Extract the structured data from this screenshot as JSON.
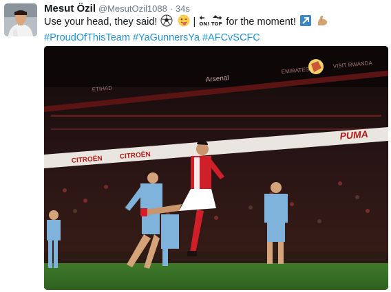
{
  "tweet": {
    "author_name": "Mesut Özil",
    "author_handle": "@MesutOzil1088",
    "separator": "·",
    "time": "34s",
    "line1_a": "Use your head, they said!",
    "line1_sep": "|",
    "line1_b": "for the moment!",
    "hashtags": [
      "#ProudOfThisTeam",
      "#YaGunnersYa",
      "#AFCvSCFC"
    ],
    "emoji_on_top_text": "ON! TOP"
  },
  "photo": {
    "stand_signs": [
      "PUMA",
      "CITROËN",
      "CITROËN",
      "Arsenal",
      "ETIHAD",
      "EMIRATES",
      "VISIT RWANDA"
    ]
  }
}
